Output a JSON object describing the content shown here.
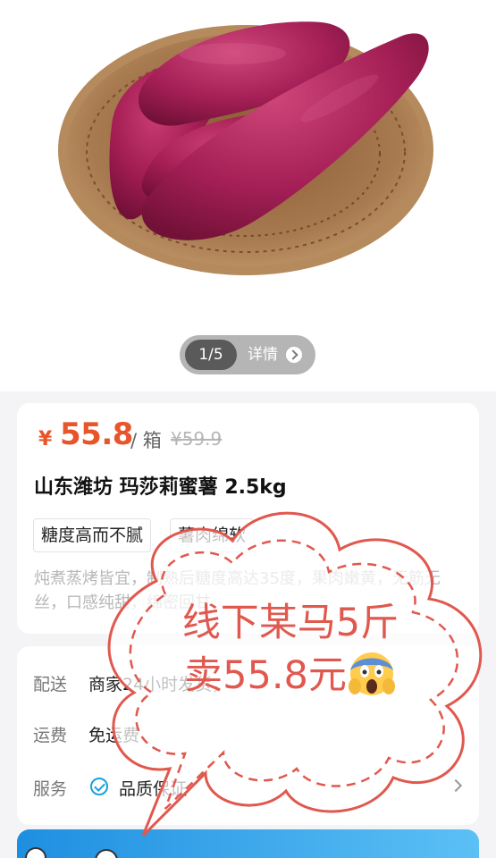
{
  "gallery": {
    "counter": "1/5",
    "detail_label": "详情"
  },
  "product": {
    "currency": "¥",
    "price": "55.8",
    "unit": "/ 箱",
    "original_price": "¥59.9",
    "title": "山东潍坊 玛莎莉蜜薯 2.5kg",
    "tags": [
      "糖度高而不腻",
      "薯肉绵软"
    ],
    "description": "炖煮蒸烤皆宜，制熟后糖度高达35度，果肉嫩黄，无筋无丝，口感纯甜，绵密回甘"
  },
  "shipping": {
    "delivery_label": "配送",
    "delivery_value": "商家24小时发货，",
    "fee_label": "运费",
    "fee_value": "免运费",
    "service_label": "服务",
    "service_value": "品质保证"
  },
  "sticker": {
    "text": "线下某马5斤卖55.8元",
    "emoji": "face-screaming-in-fear",
    "color": "#e0584e"
  },
  "colors": {
    "price": "#e8552a",
    "accent": "#1a9fe0"
  }
}
